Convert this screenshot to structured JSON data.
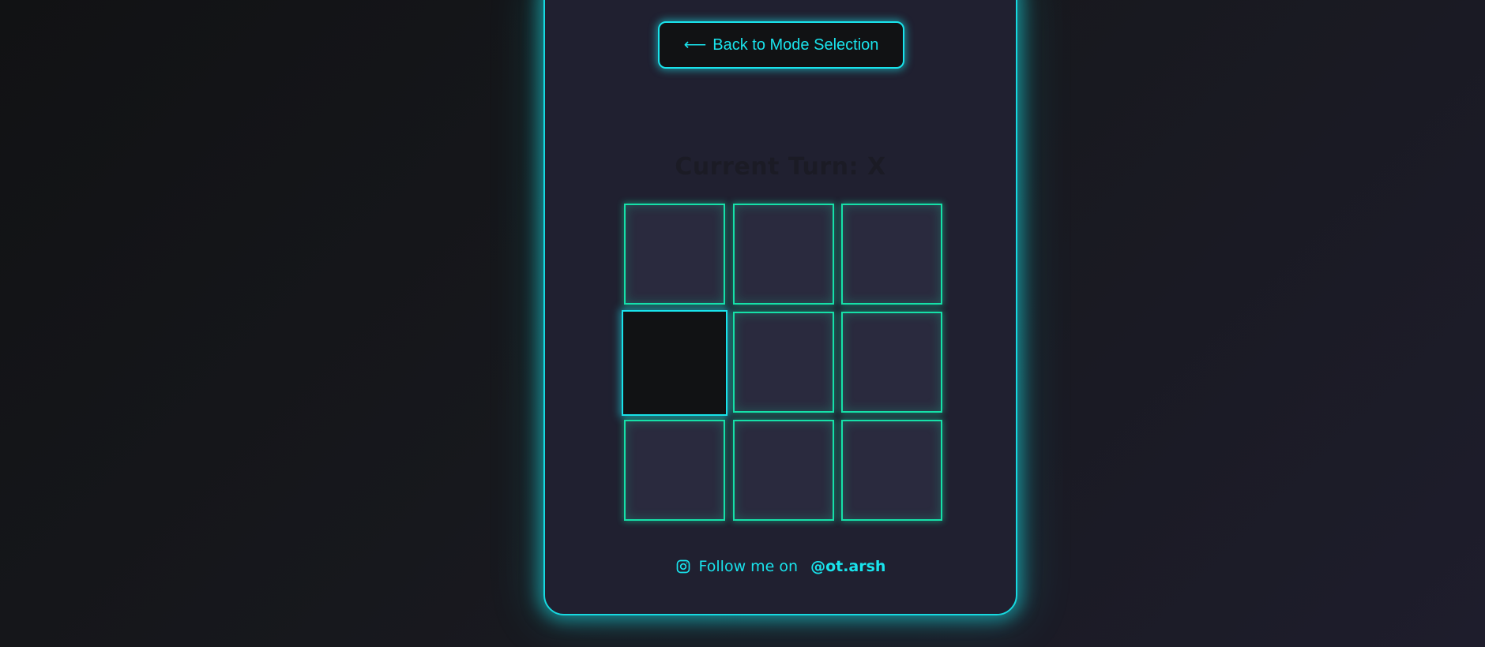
{
  "header": {
    "back_button_label": "Back to Mode Selection",
    "back_arrow_icon": "left-arrow-icon"
  },
  "game": {
    "status_text": "Current Turn: X",
    "board": [
      "",
      "",
      "",
      "",
      "",
      "",
      "",
      "",
      ""
    ],
    "highlighted_cell_index": 3
  },
  "footer": {
    "follow_text": "Follow me on",
    "handle": "@ot.arsh",
    "icon": "instagram-icon"
  },
  "colors": {
    "accent": "#19e3ec",
    "cell_border": "#16e0a8",
    "panel_bg": "#202030",
    "cell_bg": "#2a2a3e"
  }
}
